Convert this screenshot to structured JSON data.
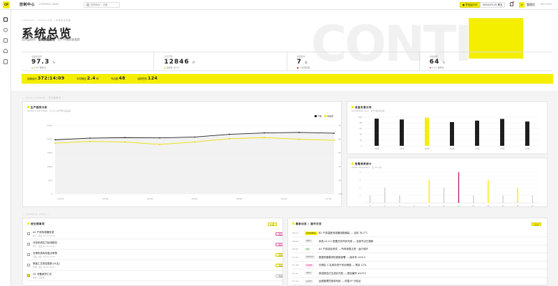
{
  "app": {
    "logo": "CP",
    "brand": "控制中心",
    "brand_sub": "CONTROL DASH",
    "search_placeholder": "搜索指标 / 设备",
    "shift_label": "● 早班运行中",
    "date_label": "2024-03-15 周五",
    "avatar": "A",
    "user": "管理员",
    "clock": "08:14:09"
  },
  "hero": {
    "breadcrumb": "CONTROL / OVERVIEW / 系统总览页面",
    "title": "系统总览",
    "subtitle_prefix": "实时监控台 · ",
    "subtitle_bold": "全域数据聚合",
    "subtitle_suffix": " · 生产环境状态追踪",
    "bg_text": "CONTI"
  },
  "stats": [
    {
      "label": "设备在线率",
      "value": "97.3",
      "unit": "%",
      "note_mark": "▲",
      "note": "1.2% 较昨日"
    },
    {
      "label": "今日产量",
      "value": "12846",
      "unit": "件",
      "note_mark": "▲",
      "note": "完成率 107%"
    },
    {
      "label": "告警事件",
      "value": "7",
      "unit": "条",
      "note_mark": "●",
      "note": "3 条待处理"
    },
    {
      "label": "综合效率",
      "value": "64",
      "unit": "%",
      "note_mark": "▼",
      "note": "2.1% 较昨日"
    }
  ],
  "ybar": [
    {
      "label": "连续运行",
      "value": "372:14:09"
    },
    {
      "label": "平均响应",
      "value": "2.4",
      "unit": "秒"
    },
    {
      "label": "节点数",
      "value": "48"
    },
    {
      "label": "活跃任务",
      "value": "124"
    }
  ],
  "sections": {
    "top": "— DATA STREAM · 实时数据流 —",
    "bottom": "— TASKS & LOGS —"
  },
  "line_card": {
    "title": "生产趋势分析",
    "sub": "PRODUCTION TREND · 近 12 小时产量与良品率",
    "more": "···",
    "legend_a": "产量",
    "legend_b": "良品率"
  },
  "bar_card": {
    "title": "设备负载分布",
    "sub": "EQUIPMENT LOAD · 各产线实时负载",
    "more": "···"
  },
  "spike_card": {
    "title": "告警频率统计",
    "sub": "ALERT FREQUENCY · 近 24 小时",
    "more": "···"
  },
  "tasks_card": {
    "title": "待处理事项",
    "badge": "5 项",
    "more": "···"
  },
  "logs_card": {
    "title": "最新动态 / 操作日志",
    "badge": "实时",
    "more": "···"
  },
  "tasks": [
    {
      "title": "A1 产线传感器校准",
      "meta": "张工 · 截止 03-15 10:00",
      "tag": "紧急",
      "tag_style": "pill-red",
      "done": false
    },
    {
      "title": "冷却系统压力检测报告",
      "meta": "李工 · 截止 03-15 12:00",
      "tag": "紧急",
      "tag_style": "pill-red",
      "done": false
    },
    {
      "title": "仓储系统库存盘点审核",
      "meta": "王磊 · 截止 03-15 15:00",
      "tag": "普通",
      "tag_style": "pill-y",
      "done": false
    },
    {
      "title": "季度工艺规范更新 (B 区)",
      "meta": "刘洋 · 截止 03-16 09:00",
      "tag": "普通",
      "tag_style": "pill-y",
      "done": false
    },
    {
      "title": "Q1 设备维护汇总",
      "meta": "陈静 · 已完成",
      "tag": "完成",
      "tag_style": "pill-g",
      "done": true
    }
  ],
  "logs": [
    {
      "time": "08:14",
      "tag": "WARNING",
      "tag_style": "tag-y",
      "text": "B2 产线温度传感器读数偏高 — 当前 78.2°C"
    },
    {
      "time": "08:09",
      "tag": "INFO",
      "tag_style": "tag-g",
      "text": "系统 v2.4.1 配置文件同步完成 — 全部节点已更新"
    },
    {
      "time": "08:02",
      "tag": "OK",
      "tag_style": "tag-gr",
      "text": "A1 产线自检完成 — 所有参数正常 · 运行良好"
    },
    {
      "time": "07:55",
      "tag": "DEPLOY",
      "tag_style": "tag-g",
      "text": "数据采集模块热更新部署 — 版本号 v3.8.2"
    },
    {
      "time": "07:48",
      "tag": "ALERT",
      "tag_style": "tag-p",
      "text": "仓储区 C 区库存低于安全阈值 — 剩余 12%"
    },
    {
      "time": "07:41",
      "tag": "INFO",
      "tag_style": "tag-g",
      "text": "夜班报告已生成并归档 — 报告编号 #4721"
    },
    {
      "time": "07:30",
      "tag": "AUTH",
      "tag_style": "tag-g",
      "text": "运维管理员登录系统 — 终端 IP 已验证"
    }
  ],
  "colors": {
    "accent": "#f4ee00",
    "alert": "#c0207a",
    "ink": "#222222"
  },
  "chart_data": [
    {
      "type": "line",
      "x": [
        "00:00",
        "01:00",
        "02:00",
        "03:00",
        "04:00",
        "05:00",
        "06:00",
        "07:00",
        "08:00"
      ],
      "series": [
        {
          "name": "产量",
          "values": [
            1980,
            2040,
            2060,
            2050,
            2080,
            2180,
            2230,
            2250,
            2220
          ]
        },
        {
          "name": "良品率",
          "values": [
            1860,
            1920,
            1900,
            1810,
            1900,
            2020,
            2060,
            2000,
            1960
          ]
        }
      ],
      "ylim": [
        0,
        2500
      ],
      "yticks": [
        0,
        500,
        1000,
        1500,
        2000,
        2500
      ],
      "y2ticks": [
        "100",
        "95",
        "90",
        "85",
        "80",
        "75"
      ],
      "xticks": [
        "00:00",
        "02:00",
        "04:00",
        "06:00",
        "08:00",
        "10:00",
        "12:00"
      ]
    },
    {
      "type": "bar",
      "categories": [
        "A1线",
        "A2线",
        "B1线",
        "B2线",
        "C1线",
        "C2线",
        "D1线"
      ],
      "values": [
        95,
        92,
        98,
        83,
        88,
        94,
        85
      ],
      "highlight": [
        2
      ],
      "ylim": [
        0,
        100
      ],
      "yticks": [
        0,
        20,
        40,
        60,
        80,
        100
      ]
    },
    {
      "type": "bar",
      "categories": [
        "0",
        "2",
        "4",
        "6",
        "8",
        "10",
        "12",
        "14",
        "16",
        "18",
        "20",
        "22"
      ],
      "values": [
        1,
        2,
        1,
        0,
        3,
        2,
        4,
        1,
        3,
        1,
        2,
        1
      ],
      "colors": [
        "g",
        "g",
        "g",
        "g",
        "y",
        "g",
        "p",
        "g",
        "y",
        "g",
        "y",
        "g"
      ],
      "ylim": [
        0,
        4
      ]
    }
  ]
}
